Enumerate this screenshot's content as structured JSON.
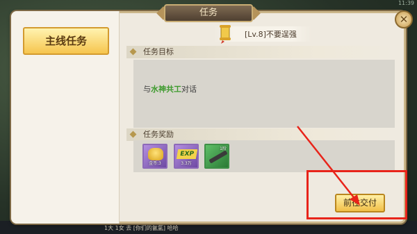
{
  "window": {
    "title": "任务",
    "close_symbol": "✕"
  },
  "sidebar": {
    "main_quest_label": "主线任务"
  },
  "quest": {
    "title": "[Lv.8]不要逞强",
    "goal_header": "任务目标",
    "goal_prefix": "与",
    "goal_npc": "水神共工",
    "goal_suffix": "对话",
    "reward_header": "任务奖励",
    "rewards": [
      {
        "name": "gold-coins",
        "qty": "金币:3"
      },
      {
        "name": "exp",
        "label": "EXP",
        "qty": "3.3万"
      },
      {
        "name": "weapon",
        "level": "1阶"
      }
    ]
  },
  "actions": {
    "deliver_label": "前往交付"
  },
  "footer": {
    "chat_text": "1大  1女  去  [你们的氤氲]  哈哈"
  },
  "status": {
    "time": "11:39"
  },
  "colors": {
    "hint": "#e8241a",
    "npc_green": "#3c9a2c",
    "button_gold": "#f1bf48"
  }
}
